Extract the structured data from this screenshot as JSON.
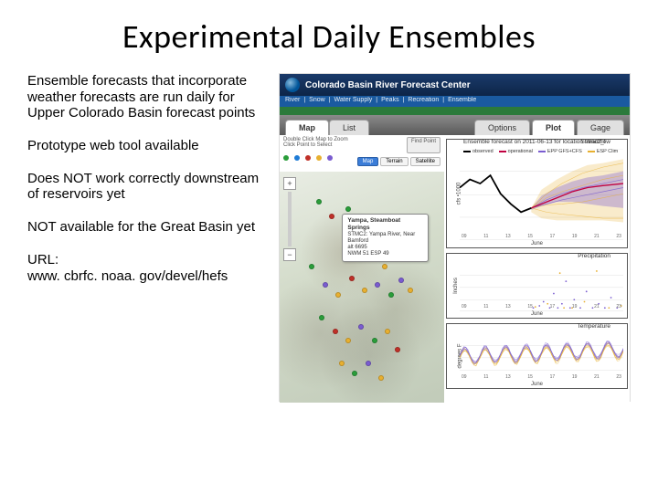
{
  "title": "Experimental Daily Ensembles",
  "bullets": {
    "p1": "Ensemble forecasts that incorporate weather forecasts are run daily for Upper Colorado Basin forecast points",
    "p2": "Prototype web tool available",
    "p3": "Does NOT work correctly downstream of reservoirs yet",
    "p4": "NOT available for the Great Basin yet",
    "p5a": "URL:",
    "p5b": "www. cbrfc. noaa. gov/devel/hefs"
  },
  "site": {
    "header": "Colorado Basin River Forecast Center",
    "nav": [
      "River",
      "Snow",
      "Water Supply",
      "Peaks",
      "Recreation",
      "Ensemble"
    ],
    "tabs": {
      "map": "Map",
      "list": "List",
      "options": "Options",
      "plot": "Plot",
      "gage": "Gage"
    },
    "map_hint1": "Double Click Map to Zoom",
    "map_hint2": "Click Point to Select",
    "find": "Find Point",
    "mapctrl": {
      "map": "Map",
      "terrain": "Terrain",
      "sat": "Satellite"
    },
    "tooltip": {
      "l1": "Yampa, Steamboat Springs",
      "l2": "STMC2: Yampa River, Near Bamford",
      "l3": "alt 6695",
      "l4": "NWM 51 ESP 49"
    }
  },
  "chart_data": [
    {
      "type": "line",
      "title": "Ensemble forecast on 2011-06-13 for location stmc2_f",
      "right_label": "Streamflow",
      "ylabel": "cfs •1000",
      "xlabel": "June",
      "xticks": [
        "09",
        "11",
        "13",
        "15",
        "17",
        "19",
        "21",
        "23"
      ],
      "ylim": [
        0,
        7
      ],
      "series": [
        {
          "name": "observed",
          "color": "#000",
          "values": [
            4.0,
            4.5,
            4.2,
            4.8,
            3.6,
            2.9,
            2.4,
            null,
            null,
            null,
            null,
            null,
            null,
            null,
            null
          ]
        },
        {
          "name": "operational",
          "color": "#c00040",
          "values": [
            null,
            null,
            null,
            null,
            null,
            null,
            2.4,
            2.6,
            3.0,
            3.4,
            3.6,
            3.9,
            4.0,
            4.1,
            4.2
          ]
        },
        {
          "name": "EPP GFS+CFS",
          "color": "#7a5cd0",
          "band": true,
          "lo": [
            null,
            null,
            null,
            null,
            null,
            null,
            2.2,
            2.0,
            2.2,
            2.4,
            2.6,
            2.8,
            3.0,
            3.0,
            3.2
          ],
          "hi": [
            null,
            null,
            null,
            null,
            null,
            null,
            2.6,
            3.4,
            4.0,
            4.6,
            5.0,
            5.2,
            5.4,
            5.4,
            5.6
          ]
        },
        {
          "name": "ESP Clim",
          "color": "#e8b030",
          "band": true,
          "lo": [
            null,
            null,
            null,
            null,
            null,
            null,
            2.2,
            1.8,
            1.8,
            1.8,
            1.8,
            1.8,
            1.8,
            1.8,
            1.8
          ],
          "hi": [
            null,
            null,
            null,
            null,
            null,
            null,
            2.6,
            3.8,
            4.4,
            5.0,
            5.4,
            5.8,
            6.0,
            6.0,
            6.2
          ]
        }
      ]
    },
    {
      "type": "scatter",
      "right_label": "Precipitation",
      "ylabel": "Inches",
      "xlabel": "June",
      "xticks": [
        "09",
        "11",
        "13",
        "15",
        "17",
        "19",
        "21",
        "23"
      ],
      "ylim": [
        0,
        0.6
      ]
    },
    {
      "type": "line",
      "right_label": "Temperature",
      "ylabel": "degrees F",
      "xlabel": "June",
      "xticks": [
        "09",
        "11",
        "13",
        "15",
        "17",
        "19",
        "21",
        "23"
      ],
      "ylim": [
        30,
        90
      ],
      "pattern": "diurnal",
      "colors": [
        "#e8b030",
        "#7a5cd0"
      ]
    }
  ]
}
